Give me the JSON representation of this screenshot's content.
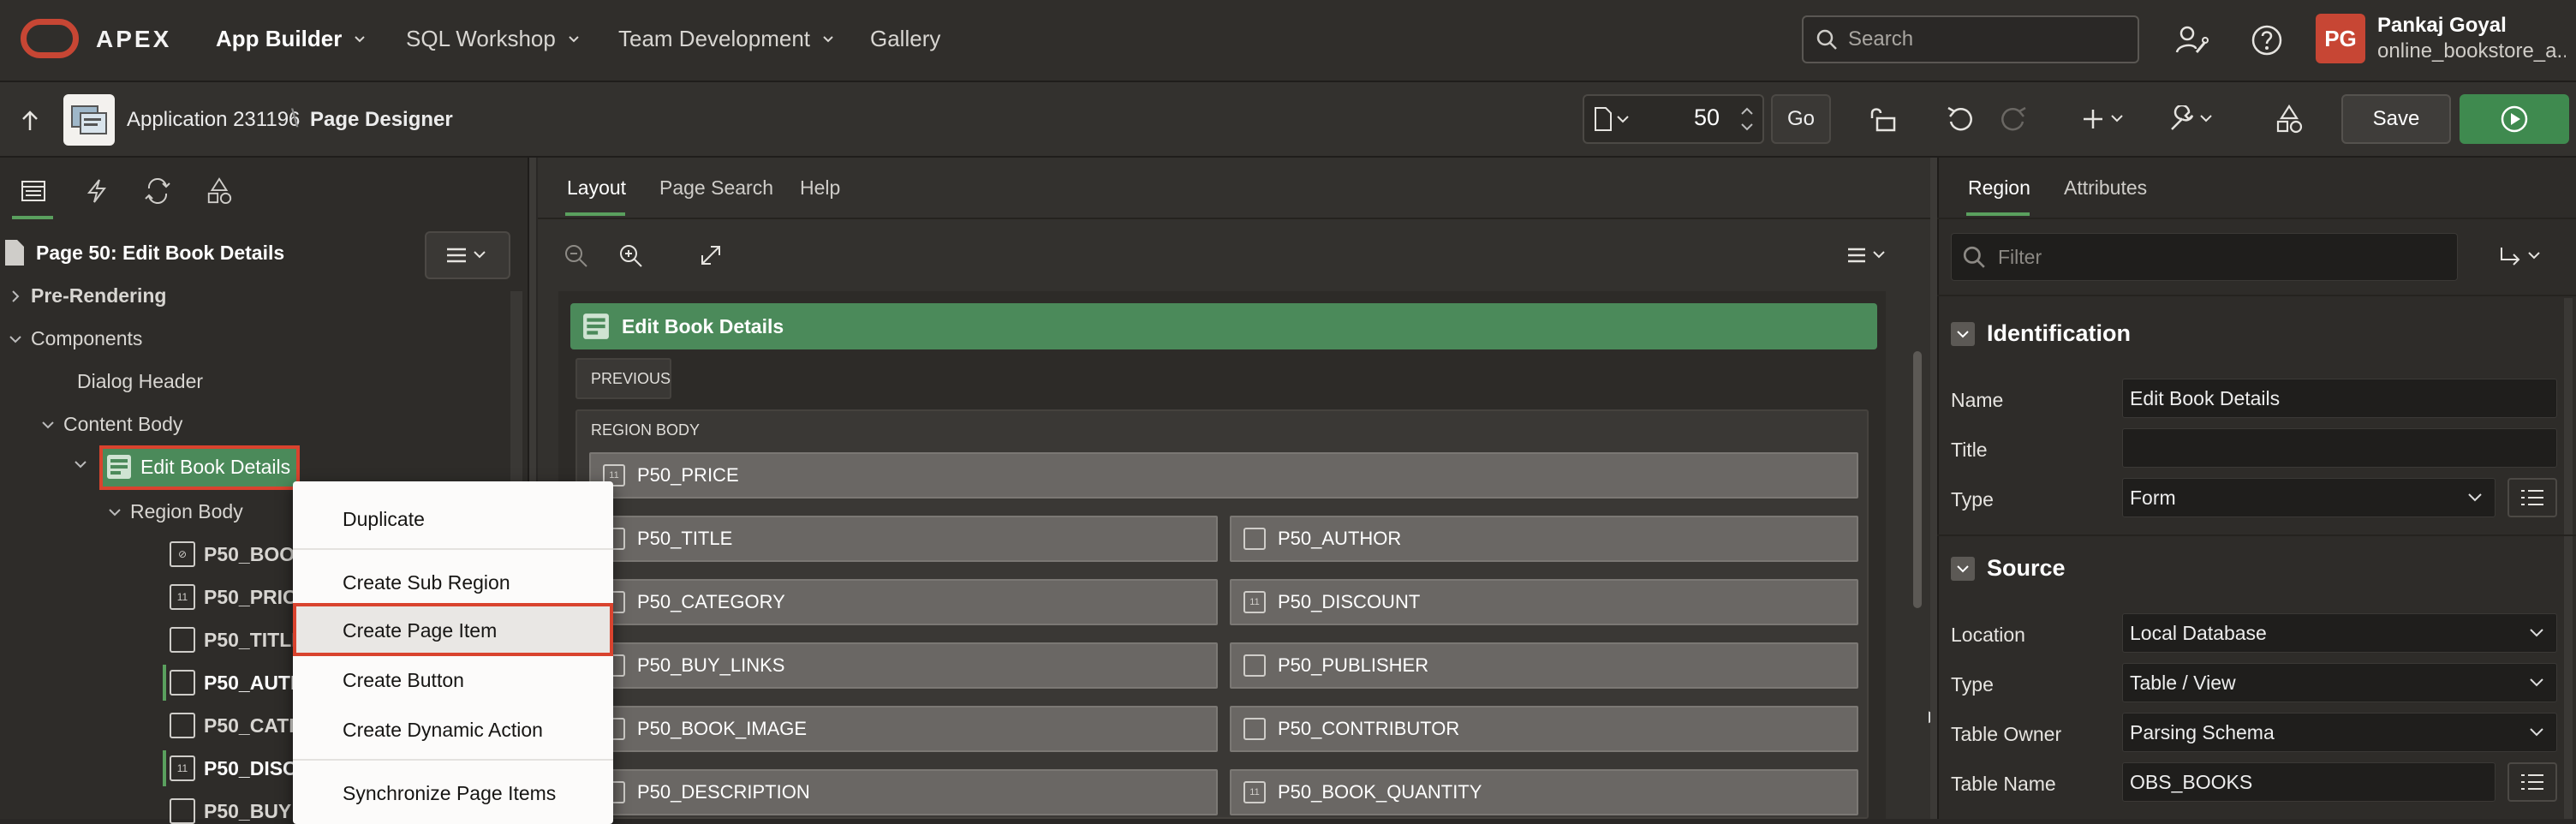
{
  "topnav": {
    "brand": "APEX",
    "items": [
      {
        "label": "App Builder"
      },
      {
        "label": "SQL Workshop"
      },
      {
        "label": "Team Development"
      },
      {
        "label": "Gallery"
      }
    ],
    "search_placeholder": "Search",
    "user": {
      "initials": "PG",
      "name": "Pankaj Goyal",
      "workspace": "online_bookstore_a..."
    }
  },
  "toolbar": {
    "application": "Application 231196",
    "page": "Page Designer",
    "page_number": "50",
    "go_label": "Go",
    "save_label": "Save"
  },
  "left": {
    "page_title": "Page 50: Edit Book Details",
    "tree": {
      "pre_rendering": "Pre-Rendering",
      "components": "Components",
      "dialog_header": "Dialog Header",
      "content_body": "Content Body",
      "edit_book_details": "Edit Book Details",
      "region_body": "Region Body",
      "items": [
        "P50_BOOK",
        "P50_PRICE",
        "P50_TITLE",
        "P50_AUTH",
        "P50_CATE",
        "P50_DISC",
        "P50_BUY"
      ]
    }
  },
  "context_menu": {
    "items": [
      "Duplicate",
      "Create Sub Region",
      "Create Page Item",
      "Create Button",
      "Create Dynamic Action",
      "Synchronize Page Items"
    ]
  },
  "middle": {
    "tabs": [
      "Layout",
      "Page Search",
      "Help"
    ],
    "region_title": "Edit Book Details",
    "previous_label": "PREVIOUS",
    "region_body_label": "REGION BODY",
    "items": {
      "price": "P50_PRICE",
      "title": "P50_TITLE",
      "author": "P50_AUTHOR",
      "category": "P50_CATEGORY",
      "discount": "P50_DISCOUNT",
      "buy_links": "P50_BUY_LINKS",
      "publisher": "P50_PUBLISHER",
      "book_image": "P50_BOOK_IMAGE",
      "contributor": "P50_CONTRIBUTOR",
      "description": "P50_DESCRIPTION",
      "book_quantity": "P50_BOOK_QUANTITY"
    }
  },
  "right": {
    "tabs": [
      "Region",
      "Attributes"
    ],
    "filter_placeholder": "Filter",
    "identification": {
      "header": "Identification",
      "name_label": "Name",
      "name_value": "Edit Book Details",
      "title_label": "Title",
      "title_value": "",
      "type_label": "Type",
      "type_value": "Form"
    },
    "source": {
      "header": "Source",
      "location_label": "Location",
      "location_value": "Local Database",
      "type_label": "Type",
      "type_value": "Table / View",
      "owner_label": "Table Owner",
      "owner_value": "Parsing Schema",
      "name_label": "Table Name",
      "name_value": "OBS_BOOKS"
    }
  },
  "colors": {
    "brand_red": "#c74634",
    "region_green": "#4b8a5a",
    "run_green": "#3f8a4f",
    "highlight": "#d9432e"
  }
}
